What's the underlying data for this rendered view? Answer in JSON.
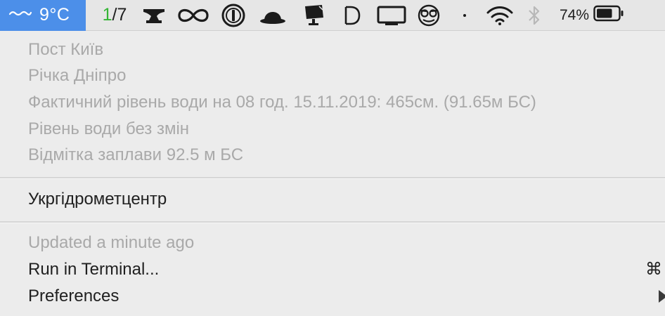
{
  "menubar": {
    "weather": {
      "icon": "wave-icon",
      "text": "9°C"
    },
    "pager": {
      "current": "1",
      "rest": "/7"
    },
    "icons": [
      "anvil-icon",
      "infinity-icon",
      "onepassword-icon",
      "bowler-hat-icon",
      "desk-lamp-icon",
      "d-logo-icon",
      "display-icon",
      "owl-icon",
      "dot-icon",
      "wifi-icon",
      "bluetooth-icon"
    ],
    "battery": {
      "percent_text": "74%",
      "level": 0.74
    }
  },
  "menu": {
    "info_lines": [
      "Пост Київ",
      "Річка Дніпро",
      "Фактичний рівень води на 08 год. 15.11.2019: 465см. (91.65м БС)",
      "Рівень води без змін",
      "Відмітка заплави 92.5 м БС"
    ],
    "source_link": "Укргідрометцентр",
    "updated_text": "Updated a minute ago",
    "run_in_terminal": "Run in Terminal...",
    "run_shortcut": "⌘",
    "preferences": "Preferences"
  },
  "colors": {
    "accent": "#4c8fe9",
    "pager_current": "#35b535",
    "disabled_text": "#a9a9a9",
    "menu_bg": "#ececec"
  }
}
